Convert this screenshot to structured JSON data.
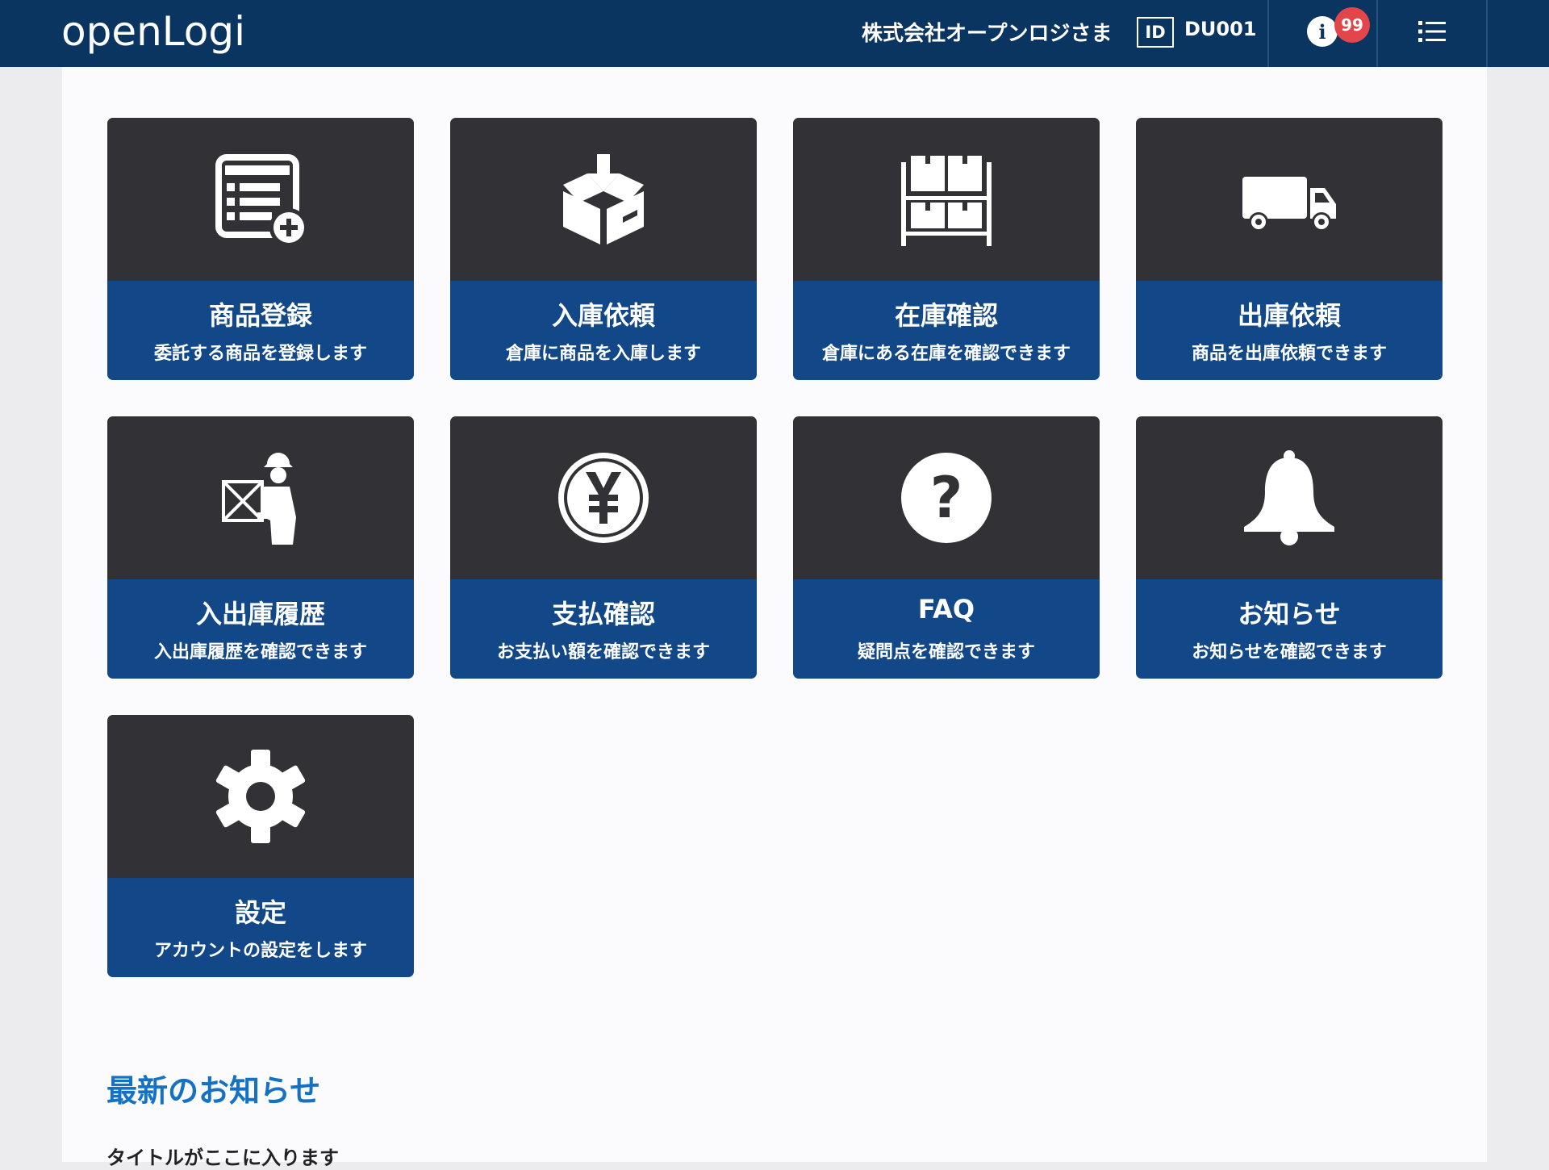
{
  "header": {
    "logo_text": "openLogi",
    "company_name": "株式会社オープンロジさま",
    "id_label": "ID",
    "id_value": "DU001",
    "info_icon": "info-icon",
    "notification_count": "99",
    "menu_icon": "list-menu-icon"
  },
  "tiles": [
    {
      "title": "商品登録",
      "desc": "委託する商品を登録します",
      "icon": "product-register-icon"
    },
    {
      "title": "入庫依頼",
      "desc": "倉庫に商品を入庫します",
      "icon": "inbound-box-icon"
    },
    {
      "title": "在庫確認",
      "desc": "倉庫にある在庫を確認できます",
      "icon": "inventory-shelf-icon"
    },
    {
      "title": "出庫依頼",
      "desc": "商品を出庫依頼できます",
      "icon": "truck-icon"
    },
    {
      "title": "入出庫履歴",
      "desc": "入出庫履歴を確認できます",
      "icon": "delivery-person-icon"
    },
    {
      "title": "支払確認",
      "desc": "お支払い額を確認できます",
      "icon": "yen-coin-icon"
    },
    {
      "title": "FAQ",
      "desc": "疑問点を確認できます",
      "icon": "question-icon"
    },
    {
      "title": "お知らせ",
      "desc": "お知らせを確認できます",
      "icon": "bell-icon"
    },
    {
      "title": "設定",
      "desc": "アカウントの設定をします",
      "icon": "gear-icon"
    }
  ],
  "news": {
    "heading": "最新のお知らせ",
    "items": [
      {
        "title": "タイトルがここに入ります"
      }
    ]
  },
  "colors": {
    "header_bg": "#0b3561",
    "tile_top": "#323135",
    "tile_bottom": "#124888",
    "badge": "#e2454a",
    "news_heading": "#1372c6"
  }
}
